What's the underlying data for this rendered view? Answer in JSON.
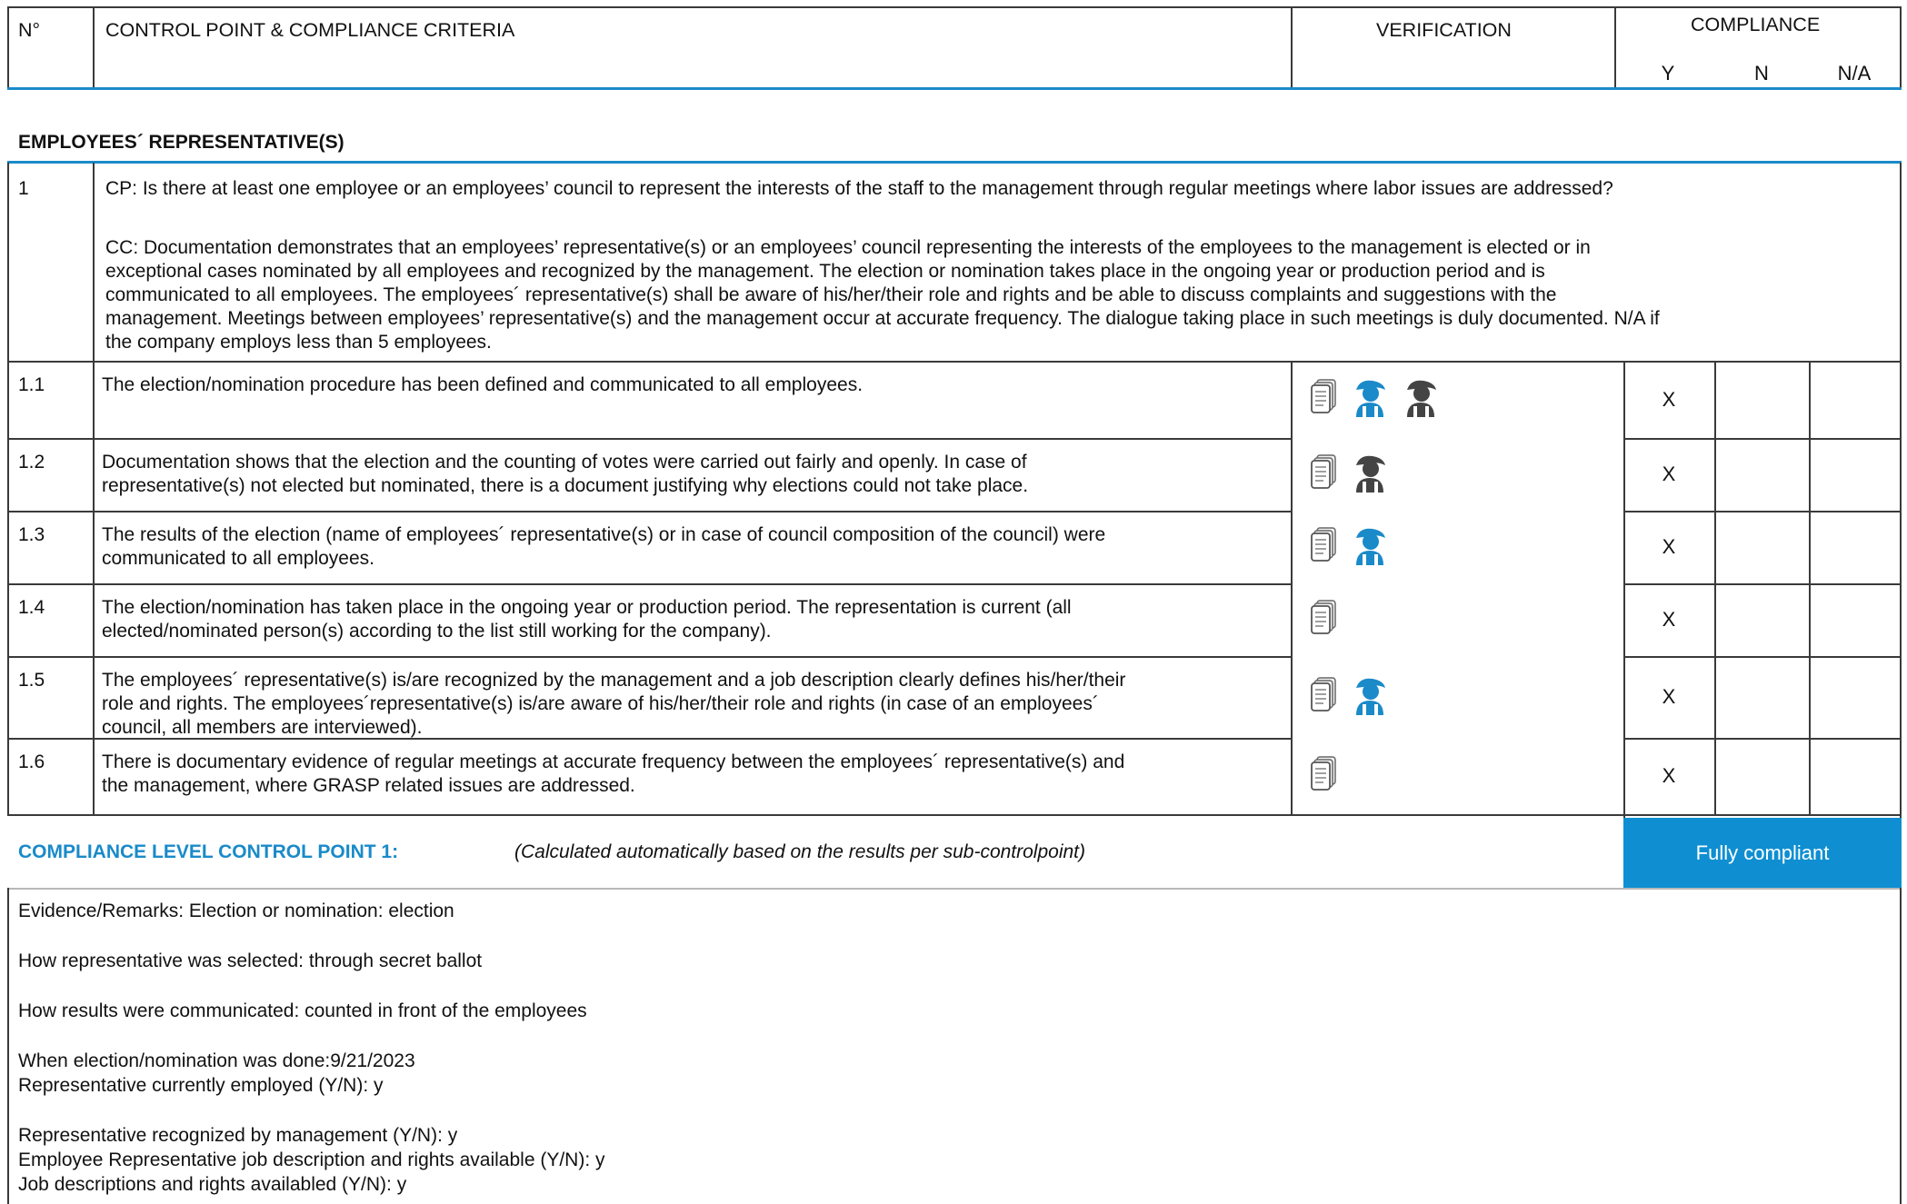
{
  "header": {
    "number_label": "N°",
    "control_point_label": "CONTROL POINT & COMPLIANCE CRITERIA",
    "verification_label": "VERIFICATION",
    "compliance_label": "COMPLIANCE",
    "col_y": "Y",
    "col_n": "N",
    "col_na": "N/A"
  },
  "section": {
    "title": "EMPLOYEES´ REPRESENTATIVE(S)"
  },
  "control_point": {
    "number": "1",
    "cp_text": "CP: Is there at least one employee or an employees’ council to represent the interests of the staff to the management through regular meetings where labor issues are addressed?",
    "cc_lines": [
      "CC: Documentation demonstrates that an employees’ representative(s) or an employees’ council representing the interests of the employees to the management is elected or in",
      "exceptional cases nominated by all employees and recognized by the management. The election or nomination takes place in the ongoing year or production period and is",
      "communicated to all employees. The employees´ representative(s) shall be aware of his/her/their role and rights and be able to discuss complaints and suggestions with the",
      "management. Meetings between employees’ representative(s) and the management occur at accurate frequency. The dialogue taking place in such meetings is duly documented. N/A if",
      "the company employs less than 5 employees."
    ]
  },
  "sub_points": [
    {
      "number": "1.1",
      "lines": [
        "The election/nomination procedure has been defined and communicated to all employees."
      ],
      "icons": [
        "document-icon",
        "interview-blue-icon",
        "interview-gray-icon"
      ],
      "mark_y": "X",
      "mark_n": "",
      "mark_na": ""
    },
    {
      "number": "1.2",
      "lines": [
        "Documentation shows that the election and the counting of votes were carried out fairly and openly. In case of",
        "representative(s) not elected but nominated, there is a document justifying why elections could not take place."
      ],
      "icons": [
        "document-icon",
        "interview-gray-icon"
      ],
      "mark_y": "X",
      "mark_n": "",
      "mark_na": ""
    },
    {
      "number": "1.3",
      "lines": [
        "The results of the election (name of employees´ representative(s) or in case of council composition of the council) were",
        "communicated to all employees."
      ],
      "icons": [
        "document-icon",
        "interview-blue-icon"
      ],
      "mark_y": "X",
      "mark_n": "",
      "mark_na": ""
    },
    {
      "number": "1.4",
      "lines": [
        "The election/nomination has taken place in the ongoing year or production period. The representation is current (all",
        "elected/nominated person(s) according to the list still working for the company)."
      ],
      "icons": [
        "document-icon"
      ],
      "mark_y": "X",
      "mark_n": "",
      "mark_na": ""
    },
    {
      "number": "1.5",
      "lines": [
        "The employees´ representative(s) is/are recognized by the management and a job description clearly defines his/her/their",
        "role and rights. The employees´representative(s) is/are aware of his/her/their role and rights (in case of an employees´",
        "council, all members are interviewed)."
      ],
      "icons": [
        "document-icon",
        "interview-blue-icon"
      ],
      "mark_y": "X",
      "mark_n": "",
      "mark_na": ""
    },
    {
      "number": "1.6",
      "lines": [
        "There is documentary evidence of regular meetings at accurate frequency between the employees´ representative(s) and",
        "the management, where GRASP related issues are addressed."
      ],
      "icons": [
        "document-icon"
      ],
      "mark_y": "X",
      "mark_n": "",
      "mark_na": ""
    }
  ],
  "compliance_level": {
    "label": "COMPLIANCE LEVEL CONTROL POINT 1:",
    "note": "(Calculated automatically based on the results per sub-controlpoint)",
    "result": "Fully compliant",
    "result_color": "#0f8fd1"
  },
  "remarks": [
    "Evidence/Remarks: Election or nomination: election",
    "How representative was selected: through secret ballot",
    "How results were communicated: counted in front of the employees",
    "When election/nomination was done:9/21/2023",
    "Representative currently employed (Y/N): y",
    "Representative recognized by management (Y/N): y",
    "Employee Representative job description and rights available (Y/N): y",
    "Job descriptions and rights availabled (Y/N): y"
  ]
}
